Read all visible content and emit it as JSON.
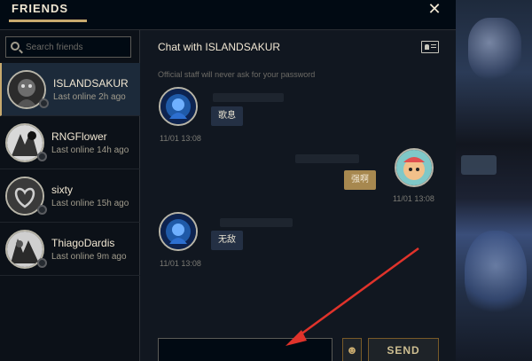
{
  "header": {
    "title": "FRIENDS",
    "close_icon": "close-icon"
  },
  "search": {
    "placeholder": "Search friends"
  },
  "friends": [
    {
      "name": "ISLANDSAKUR",
      "status": "Last online 2h ago",
      "active": true
    },
    {
      "name": "RNGFlower",
      "status": "Last online 14h ago",
      "active": false
    },
    {
      "name": "sixty",
      "status": "Last online 15h ago",
      "active": false
    },
    {
      "name": "ThiagoDardis",
      "status": "Last online 9m ago",
      "active": false
    }
  ],
  "chat": {
    "title": "Chat with ISLANDSAKUR",
    "notice": "Official staff will never ask for your password",
    "messages": [
      {
        "direction": "in",
        "text": "歌息",
        "timestamp": "11/01 13:08"
      },
      {
        "direction": "out",
        "text": "强啊",
        "timestamp": "11/01 13:08"
      },
      {
        "direction": "in",
        "text": "无敌",
        "timestamp": "11/01 13:08"
      }
    ],
    "send_label": "SEND",
    "emoji_icon": "emoji-icon"
  },
  "colors": {
    "accent": "#c8aa6e",
    "outgoing_bubble": "#a7884f",
    "incoming_bubble": "#243044",
    "annotation_arrow": "#e0332b"
  }
}
